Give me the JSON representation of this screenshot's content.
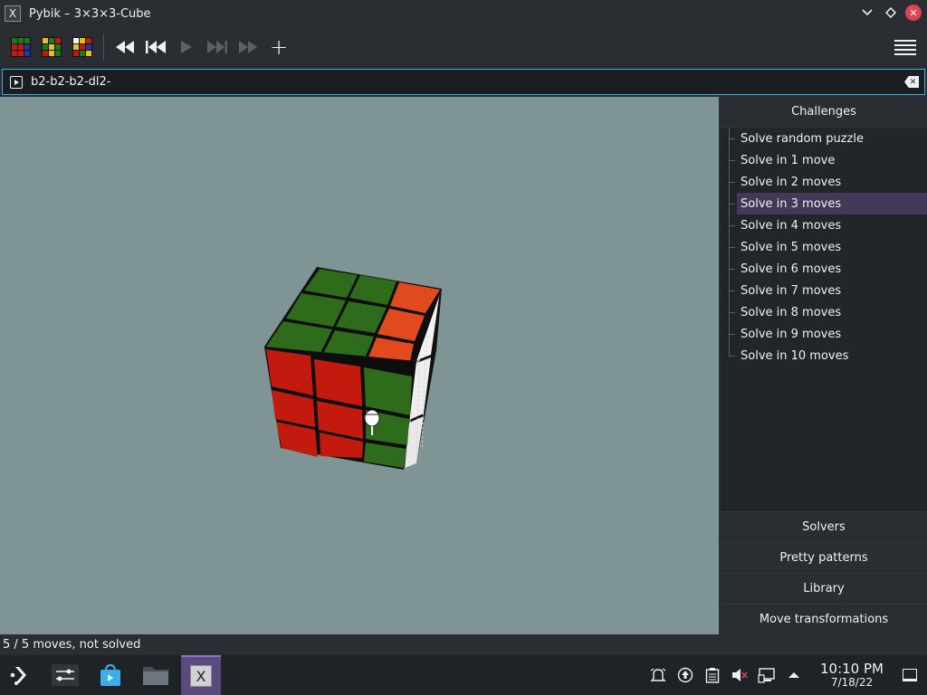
{
  "window": {
    "title": "Pybik – 3×3×3-Cube",
    "app_icon": "X"
  },
  "toolbar": {
    "buttons": [
      {
        "name": "new-solved-cube",
        "icon": "cube-solved-icon"
      },
      {
        "name": "new-random-cube",
        "icon": "cube-random-icon"
      },
      {
        "name": "puzzle-type",
        "icon": "cube-mixed-icon"
      },
      {
        "name": "rewind",
        "icon": "rewind-icon"
      },
      {
        "name": "previous",
        "icon": "skip-previous-icon"
      },
      {
        "name": "play",
        "icon": "play-icon",
        "enabled": false
      },
      {
        "name": "next",
        "icon": "skip-next-icon",
        "enabled": false
      },
      {
        "name": "forward",
        "icon": "fast-forward-icon",
        "enabled": false
      },
      {
        "name": "add-mark",
        "icon": "plus-icon"
      }
    ],
    "plus_glyph": "+"
  },
  "move_edit": {
    "value": "b2-b2-b2-dl2-"
  },
  "challenges": {
    "header": "Challenges",
    "items": [
      {
        "label": "Solve random puzzle"
      },
      {
        "label": "Solve in 1 move"
      },
      {
        "label": "Solve in 2 moves"
      },
      {
        "label": "Solve in 3 moves",
        "selected": true
      },
      {
        "label": "Solve in 4 moves"
      },
      {
        "label": "Solve in 5 moves"
      },
      {
        "label": "Solve in 6 moves"
      },
      {
        "label": "Solve in 7 moves"
      },
      {
        "label": "Solve in 8 moves"
      },
      {
        "label": "Solve in 9 moves"
      },
      {
        "label": "Solve in 10 moves"
      }
    ]
  },
  "panel_sections": {
    "solvers": "Solvers",
    "pretty_patterns": "Pretty patterns",
    "library": "Library",
    "move_transformations": "Move transformations"
  },
  "status": {
    "text": "5 / 5 moves, not solved"
  },
  "taskbar": {
    "clock_time": "10:10 PM",
    "clock_date": "7/18/22"
  },
  "colors": {
    "cube_green": "#2e6b1a",
    "cube_red": "#c21a0e",
    "cube_orange": "#e04a1c",
    "cube_white": "#f4f4f4",
    "viewport_bg": "#7f9494",
    "selection": "#44385a",
    "accent": "#3daee9"
  }
}
